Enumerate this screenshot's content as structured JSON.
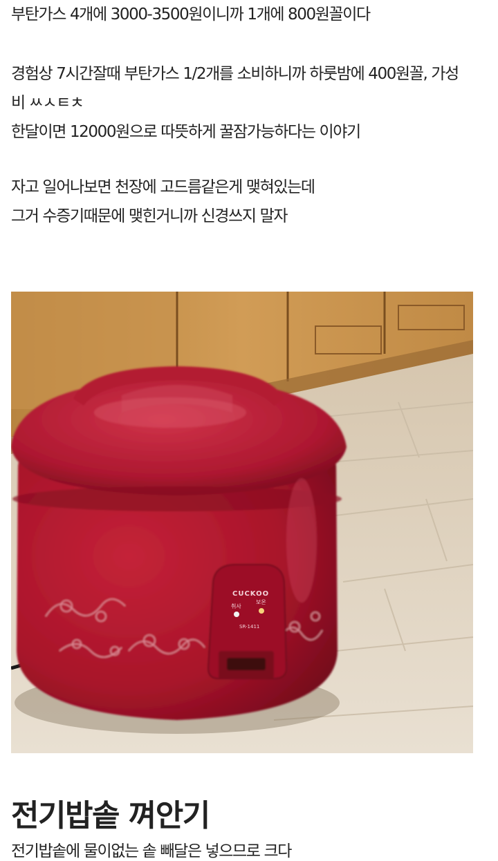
{
  "article": {
    "paragraph1": [
      "부탄가스 4개에 3000-3500원이니까 1개에 800원꼴이다"
    ],
    "paragraph2": [
      "경험상 7시간잘때 부탄가스 1/2개를 소비하니까 하룻밤에 400원꼴, 가성",
      "비 ㅆㅅㅌㅊ",
      "한달이면 12000원으로 따뜻하게 꿀잠가능하다는 이야기"
    ],
    "paragraph3": [
      "자고 일어나보면 천장에 고드름같은게 맺혀있는데",
      "그거 수증기때문에 맺힌거니까 신경쓰지 말자"
    ],
    "image": {
      "brand_text": "CUCKOO",
      "button_labels": [
        "취사",
        "보온"
      ],
      "model_text": "SR-1411",
      "colors": {
        "cooker": "#b0162c",
        "floor": "#ddd1bf",
        "cabinet": "#c8954e"
      }
    },
    "section_heading": "전기밥솥 껴안기",
    "next_line_partial": "전기밥솥에 물이없는 솥 빼달은 넣으므로 크다"
  }
}
